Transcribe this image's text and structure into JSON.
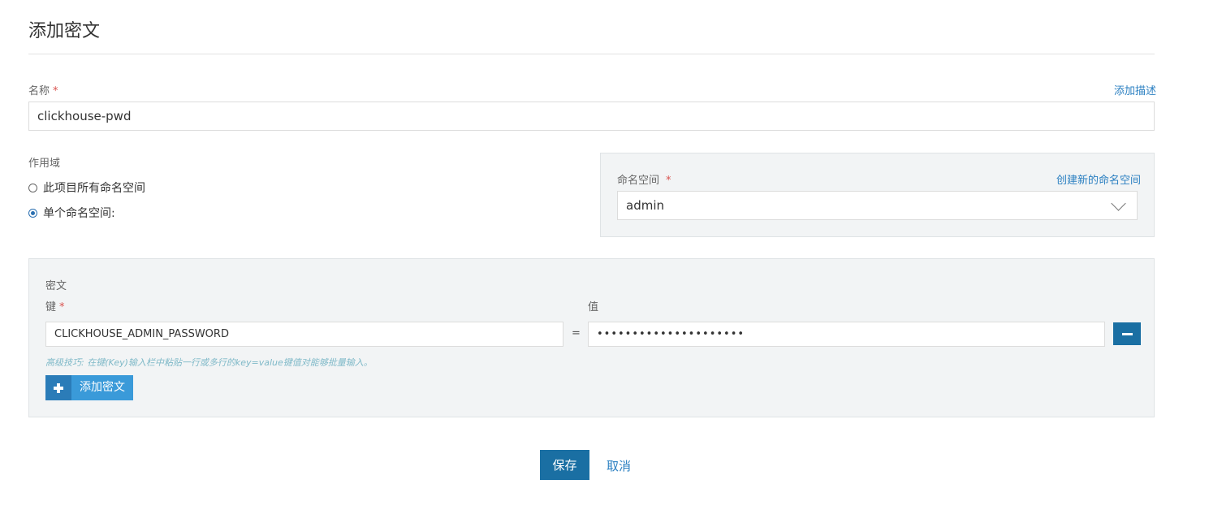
{
  "page": {
    "title": "添加密文"
  },
  "name_field": {
    "label": "名称",
    "required_mark": "*",
    "value": "clickhouse-pwd",
    "add_description_link": "添加描述"
  },
  "scope": {
    "label": "作用域",
    "options": [
      {
        "label": "此项目所有命名空间",
        "checked": false
      },
      {
        "label": "单个命名空间:",
        "checked": true
      }
    ]
  },
  "namespace": {
    "label": "命名空间",
    "required_mark": "*",
    "create_link": "创建新的命名空间",
    "selected": "admin"
  },
  "secrets": {
    "section_label": "密文",
    "key_label": "键",
    "key_required_mark": "*",
    "value_label": "值",
    "equals": "=",
    "entries": [
      {
        "key": "CLICKHOUSE_ADMIN_PASSWORD",
        "value": "•••••••••••••••••••••"
      }
    ],
    "tip": "高级技巧: 在键(Key)输入栏中粘贴一行或多行的key=value键值对能够批量输入。",
    "add_button_label": "添加密文"
  },
  "actions": {
    "save_label": "保存",
    "cancel_label": "取消"
  },
  "colors": {
    "primary": "#1a6fa3",
    "link": "#2a7fc1",
    "required": "#d9534f",
    "panel_bg": "#f2f4f5"
  }
}
